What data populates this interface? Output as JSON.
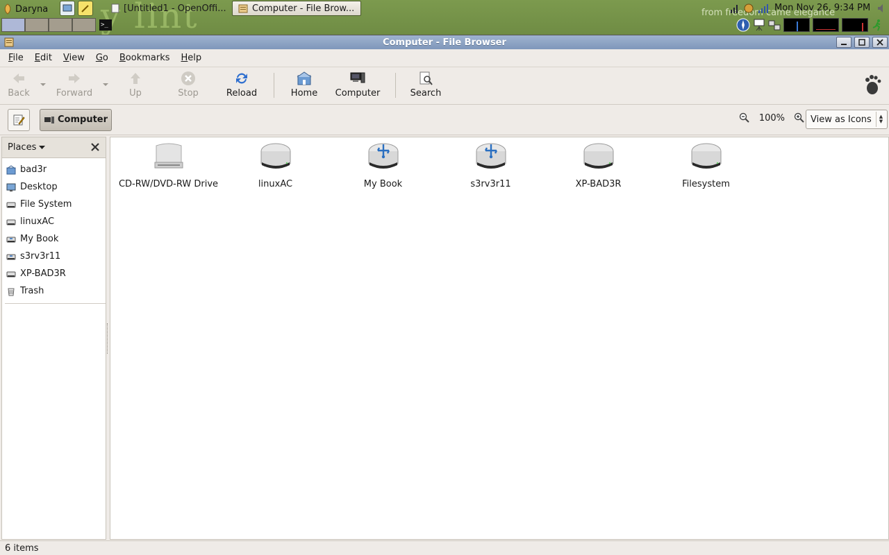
{
  "panel": {
    "user_menu": "Daryna",
    "tasks": [
      {
        "label": "[Untitled1 - OpenOffi..."
      },
      {
        "label": "Computer - File Brow..."
      }
    ],
    "clock": "Mon Nov 26,  9:34 PM",
    "wallpaper_text": "from freedom came elegance"
  },
  "window": {
    "title": "Computer - File Browser"
  },
  "menubar": {
    "items": [
      {
        "label": "File",
        "mnemonic": "F",
        "rest": "ile"
      },
      {
        "label": "Edit",
        "mnemonic": "E",
        "rest": "dit"
      },
      {
        "label": "View",
        "mnemonic": "V",
        "rest": "iew"
      },
      {
        "label": "Go",
        "mnemonic": "G",
        "rest": "o"
      },
      {
        "label": "Bookmarks",
        "mnemonic": "B",
        "rest": "ookmarks"
      },
      {
        "label": "Help",
        "mnemonic": "H",
        "rest": "elp"
      }
    ]
  },
  "toolbar": {
    "back": "Back",
    "forward": "Forward",
    "up": "Up",
    "stop": "Stop",
    "reload": "Reload",
    "home": "Home",
    "computer": "Computer",
    "search": "Search"
  },
  "location": {
    "crumb": "Computer",
    "zoom": "100%",
    "view_mode": "View as Icons"
  },
  "sidebar": {
    "title": "Places",
    "items": [
      {
        "label": "bad3r",
        "icon": "home-folder-icon"
      },
      {
        "label": "Desktop",
        "icon": "desktop-icon"
      },
      {
        "label": "File System",
        "icon": "drive-icon"
      },
      {
        "label": "linuxAC",
        "icon": "drive-icon"
      },
      {
        "label": "My Book",
        "icon": "usb-drive-icon"
      },
      {
        "label": "s3rv3r11",
        "icon": "usb-drive-icon"
      },
      {
        "label": "XP-BAD3R",
        "icon": "drive-icon"
      },
      {
        "label": "Trash",
        "icon": "trash-icon"
      }
    ]
  },
  "drives": [
    {
      "label": "CD-RW/DVD-RW Drive",
      "icon": "optical-drive-icon"
    },
    {
      "label": "linuxAC",
      "icon": "hard-drive-icon"
    },
    {
      "label": "My Book",
      "icon": "usb-drive-icon"
    },
    {
      "label": "s3rv3r11",
      "icon": "usb-drive-icon"
    },
    {
      "label": "XP-BAD3R",
      "icon": "hard-drive-icon"
    },
    {
      "label": "Filesystem",
      "icon": "hard-drive-icon"
    }
  ],
  "status": {
    "text": "6 items"
  },
  "colors": {
    "panel": "#7c9a4e",
    "titlebar": "#8ea5c6",
    "window_bg": "#efebe7",
    "usb_blue": "#2a6fc1"
  }
}
